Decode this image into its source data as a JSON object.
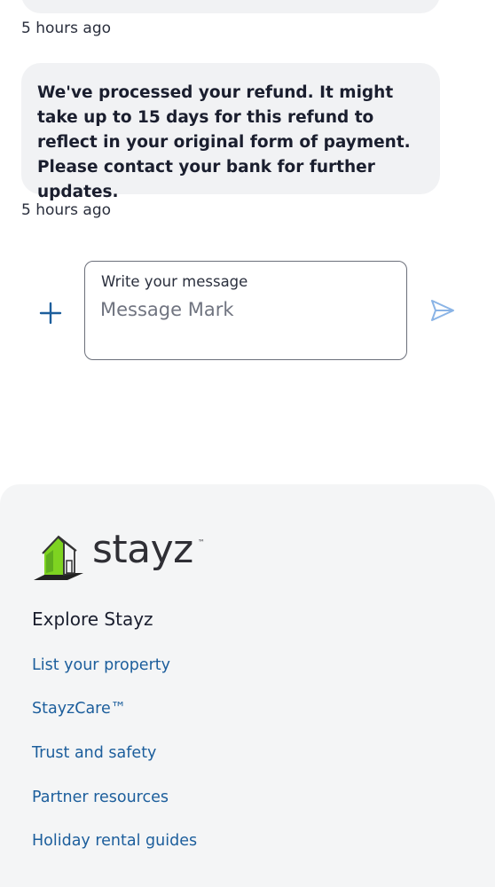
{
  "chat": {
    "earlier_timestamp": "5 hours ago",
    "message": {
      "text": "We've processed your refund. It might take up to 15 days for this refund to reflect in your original form of payment. Please contact your bank for further updates.",
      "timestamp": "5 hours ago"
    }
  },
  "composer": {
    "label": "Write your message",
    "placeholder": "Message Mark",
    "value": "",
    "add_icon": "plus-icon",
    "send_icon": "send-icon"
  },
  "footer": {
    "logo_text": "stayz",
    "logo_tm": "™",
    "section_title": "Explore Stayz",
    "links": [
      "List your property",
      "StayzCare™",
      "Trust and safety",
      "Partner resources",
      "Holiday rental guides"
    ]
  },
  "colors": {
    "accent_blue": "#1c5e9c",
    "send_icon_light_blue": "#8ab4e6",
    "bubble_bg": "#f1f2f4",
    "footer_bg": "#f4f5f6",
    "logo_green": "#7ed321"
  }
}
